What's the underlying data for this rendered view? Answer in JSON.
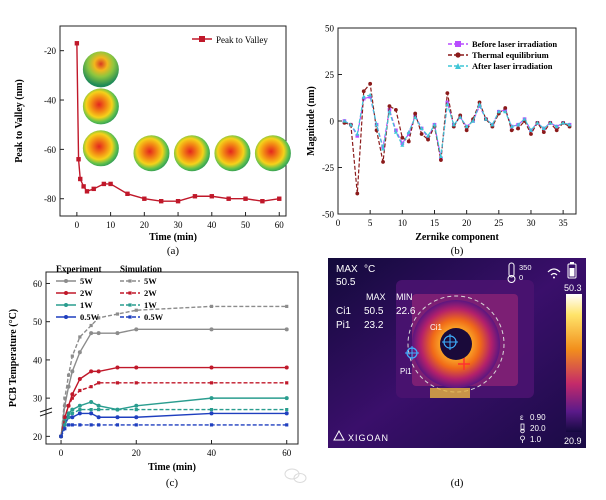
{
  "colors": {
    "red": "#c0182a",
    "darkred": "#8b1a1a",
    "gray": "#8c8c8c",
    "teal": "#2a9d8f",
    "blue": "#1f3fbf",
    "violet": "#b84dff",
    "cyan": "#3fc6d6"
  },
  "chart_data": [
    {
      "id": "a",
      "type": "line",
      "panel_label": "(a)",
      "xlabel": "Time (min)",
      "ylabel": "Peak to Valley (nm)",
      "xlim": [
        -5,
        62
      ],
      "ylim": [
        -87,
        -10
      ],
      "xticks": [
        0,
        10,
        20,
        30,
        40,
        50,
        60
      ],
      "yticks": [
        -80,
        -60,
        -40,
        -20
      ],
      "legend_position": "top-right",
      "series": [
        {
          "name": "Peak to Valley",
          "x": [
            0,
            0.5,
            1,
            2,
            3,
            5,
            8,
            10,
            15,
            20,
            25,
            30,
            35,
            40,
            45,
            50,
            55,
            60
          ],
          "y": [
            -17,
            -64,
            -72,
            -75,
            -77,
            -76,
            -74,
            -74,
            -78,
            -80,
            -81,
            -81,
            -79,
            -79,
            -80,
            -80,
            -81,
            -80
          ]
        }
      ],
      "inset_maps": 7
    },
    {
      "id": "b",
      "type": "line",
      "panel_label": "(b)",
      "xlabel": "Zernike component",
      "ylabel": "Magnitude (nm)",
      "xlim": [
        0,
        37
      ],
      "ylim": [
        -50,
        50
      ],
      "xticks": [
        0,
        5,
        10,
        15,
        20,
        25,
        30,
        35
      ],
      "yticks": [
        -50,
        -25,
        0,
        25,
        50
      ],
      "legend_position": "top-right",
      "x": [
        1,
        2,
        3,
        4,
        5,
        6,
        7,
        8,
        9,
        10,
        11,
        12,
        13,
        14,
        15,
        16,
        17,
        18,
        19,
        20,
        21,
        22,
        23,
        24,
        25,
        26,
        27,
        28,
        29,
        30,
        31,
        32,
        33,
        34,
        35,
        36
      ],
      "series": [
        {
          "name": "Before laser irradiation",
          "values": [
            0,
            -2,
            -8,
            12,
            13,
            -2,
            -14,
            6,
            -5,
            -12,
            -7,
            3,
            -4,
            -9,
            -2,
            -20,
            10,
            -2,
            2,
            -3,
            0,
            8,
            1,
            -2,
            5,
            6,
            -3,
            -2,
            1,
            -5,
            -1,
            -4,
            -1,
            -3,
            -1,
            -2
          ]
        },
        {
          "name": "Thermal equilibrium",
          "values": [
            -1,
            -2,
            -39,
            16,
            20,
            -5,
            -22,
            8,
            6,
            -9,
            -11,
            4,
            -7,
            -10,
            -3,
            -21,
            15,
            -3,
            3,
            -5,
            1,
            10,
            1,
            -3,
            4,
            7,
            -5,
            -4,
            0,
            -7,
            -1,
            -6,
            -1,
            -5,
            -1,
            -3
          ]
        },
        {
          "name": "After laser irradiation",
          "values": [
            0,
            -2,
            -7,
            13,
            14,
            -2,
            -15,
            5,
            -6,
            -13,
            -6,
            2,
            -4,
            -8,
            -2,
            -19,
            9,
            -2,
            2,
            -3,
            0,
            9,
            1,
            -2,
            5,
            5,
            -3,
            -2,
            1,
            -5,
            -1,
            -4,
            -1,
            -3,
            -1,
            -2
          ]
        }
      ]
    },
    {
      "id": "c",
      "type": "line",
      "panel_label": "(c)",
      "xlabel": "Time (min)",
      "ylabel": "PCB Temperature (°C)",
      "xlim": [
        -4,
        63
      ],
      "ylim": [
        18,
        63
      ],
      "xticks": [
        0,
        20,
        40,
        60
      ],
      "yticks": [
        20,
        30,
        40,
        50,
        60
      ],
      "legend_heading_experiment": "Experiment",
      "legend_heading_simulation": "Simulation",
      "legend_position": "top-left",
      "series": [
        {
          "name": "5W",
          "kind": "experiment",
          "color_key": "gray",
          "x": [
            0,
            1,
            2,
            3,
            5,
            8,
            10,
            15,
            20,
            40,
            60
          ],
          "y": [
            20,
            28,
            33,
            37,
            42,
            47,
            47,
            47,
            48,
            48,
            48
          ]
        },
        {
          "name": "2W",
          "kind": "experiment",
          "color_key": "red",
          "x": [
            0,
            1,
            2,
            3,
            5,
            8,
            10,
            15,
            20,
            40,
            60
          ],
          "y": [
            20,
            25,
            28,
            31,
            35,
            37,
            37,
            38,
            38,
            38,
            38
          ]
        },
        {
          "name": "1W",
          "kind": "experiment",
          "color_key": "teal",
          "x": [
            0,
            1,
            2,
            3,
            5,
            8,
            10,
            15,
            20,
            40,
            60
          ],
          "y": [
            20,
            24,
            26,
            27,
            28,
            29,
            28,
            27,
            28,
            30,
            30
          ]
        },
        {
          "name": "0.5W",
          "kind": "experiment",
          "color_key": "blue",
          "x": [
            0,
            1,
            2,
            3,
            5,
            8,
            10,
            15,
            20,
            40,
            60
          ],
          "y": [
            20,
            23,
            25,
            25,
            26,
            26,
            25,
            25,
            25,
            26,
            26
          ]
        },
        {
          "name": "5W",
          "kind": "simulation",
          "color_key": "gray",
          "x": [
            0,
            1,
            2,
            3,
            5,
            8,
            10,
            15,
            20,
            40,
            60
          ],
          "y": [
            20,
            30,
            36,
            41,
            46,
            49,
            51,
            52,
            53,
            54,
            54
          ]
        },
        {
          "name": "2W",
          "kind": "simulation",
          "color_key": "red",
          "x": [
            0,
            1,
            2,
            3,
            5,
            8,
            10,
            15,
            20,
            40,
            60
          ],
          "y": [
            20,
            25,
            28,
            30,
            32,
            33,
            34,
            34,
            34,
            34,
            34
          ]
        },
        {
          "name": "1W",
          "kind": "simulation",
          "color_key": "teal",
          "x": [
            0,
            1,
            2,
            3,
            5,
            8,
            10,
            15,
            20,
            40,
            60
          ],
          "y": [
            20,
            23,
            25,
            26,
            27,
            27,
            27,
            27,
            27,
            27,
            27
          ]
        },
        {
          "name": "0.5W",
          "kind": "simulation",
          "color_key": "blue",
          "x": [
            0,
            1,
            2,
            3,
            5,
            8,
            10,
            15,
            20,
            40,
            60
          ],
          "y": [
            20,
            22,
            23,
            23,
            23,
            23,
            23,
            23,
            23,
            23,
            23
          ]
        }
      ]
    }
  ],
  "thermal": {
    "panel_label": "(d)",
    "max_label": "MAX",
    "max_value": "50.5",
    "unit": "°C",
    "col_max": "MAX",
    "col_min": "MIN",
    "ci1_label": "Ci1",
    "ci1_max": "50.5",
    "ci1_min": "22.6",
    "pi1_label": "Pi1",
    "pi1_value": "23.2",
    "thermo_top": "350",
    "thermo_bottom": "0",
    "scale_top": "50.3",
    "scale_bottom": "20.9",
    "emissivity": "0.90",
    "reflect_temp": "20.0",
    "distance": "1.0",
    "brand": "XIGOAN",
    "marker_ci1": "Ci1",
    "marker_pi1": "Pi1"
  }
}
